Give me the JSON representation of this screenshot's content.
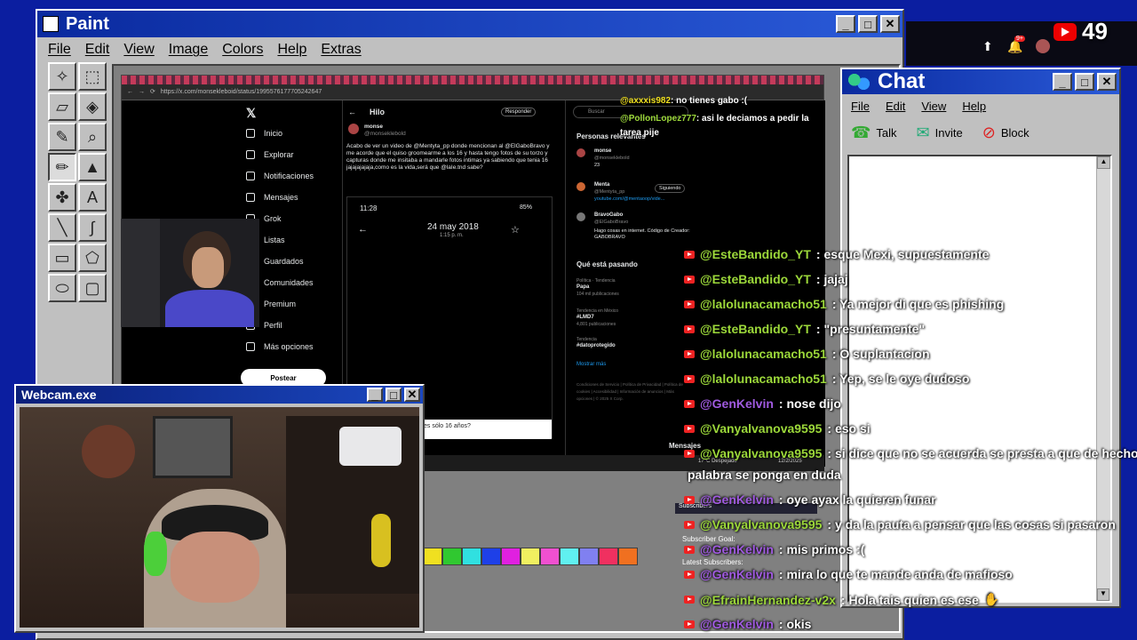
{
  "paint": {
    "title": "Paint",
    "menu": [
      "File",
      "Edit",
      "View",
      "Image",
      "Colors",
      "Help",
      "Extras"
    ],
    "palette": [
      "#f0e020",
      "#30c830",
      "#30e0e0",
      "#1e40e8",
      "#e020e0",
      "#f0f060",
      "#f050d0",
      "#60f0f0",
      "#8080f0",
      "#f03060",
      "#f07020"
    ]
  },
  "browser": {
    "url": "https://x.com/monsekleboid/status/1995576177705242647",
    "tab_reply": "Responder",
    "search_placeholder": "Buscar",
    "nav": [
      "Inicio",
      "Explorar",
      "Notificaciones",
      "Mensajes",
      "Grok",
      "Listas",
      "Guardados",
      "Comunidades",
      "Premium",
      "Perfil",
      "Más opciones"
    ],
    "post_button": "Postear",
    "thread_title": "Hilo",
    "author_name": "monse",
    "author_handle": "@monseklebold",
    "tweet_text": "Acabo de ver un video de @Mentyta_pp donde mencionan al @ElGaboBravo y me acorde que el quiso groomearme a los 16 y hasta tengo fotos de su torzo y capturas donde me insitaba a mandarle fotos intimas ya sabiendo que tenia 16 jajajajajaja,como es la vida,será que @laIe.tnd sabe?",
    "phone_time": "11:28",
    "phone_battery": "85%",
    "phone_date": "24 may 2018",
    "phone_subdate": "1:15 p. m.",
    "phone_caption": "es sólo 16 años?",
    "relevant_title": "Personas relevantes",
    "relevant": [
      {
        "name": "monse",
        "handle": "@monseklebold",
        "extra": "23"
      },
      {
        "name": "Menta",
        "handle": "@Mentyta_pp",
        "extra": "youtube.com/@mentaoop/vide...",
        "action": "Siguiendo"
      },
      {
        "name": "BravoGabo",
        "handle": "@ElGaboBravo",
        "extra": "Hago cosas en internet. Código de Creador: GABOBRAVO"
      }
    ],
    "trending_title": "Qué está pasando",
    "trends": [
      {
        "ctx": "Política · Tendencia",
        "name": "Papa",
        "count": "104 mil publicaciones"
      },
      {
        "ctx": "Tendencia en México",
        "name": "#LMD7",
        "count": "4,801 publicaciones"
      },
      {
        "ctx": "Tendencia",
        "name": "#datoprotegido",
        "count": ""
      }
    ],
    "show_more": "Mostrar más",
    "messages": "Mensajes",
    "footer": "Condiciones de Servicio | Política de Privacidad | Política de cookies | Accesibilidad | Información de anuncios | Más opciones | © 2025 X Corp.",
    "taskbar_weather": "17°C Despejado",
    "taskbar_date": "12/2/2025"
  },
  "webcam": {
    "title": "Webcam.exe"
  },
  "chat": {
    "title": "Chat",
    "menu": [
      "File",
      "Edit",
      "View",
      "Help"
    ],
    "tools": [
      {
        "label": "Talk",
        "icon": "talk-icon"
      },
      {
        "label": "Invite",
        "icon": "invite-icon"
      },
      {
        "label": "Block",
        "icon": "block-icon"
      }
    ]
  },
  "stream": {
    "viewers": "49",
    "notif_count": "9+",
    "overlay_subscribers": "Subscribers",
    "overlay_goal": "Subscriber Goal:",
    "overlay_latest": "Latest Subscribers:"
  },
  "chat_messages": [
    {
      "user": "@axxxis982",
      "text": ": no tienes gabo :(",
      "color": "#f0e020"
    },
    {
      "user": "@PollonLopez777",
      "text": ": asi le deciamos a pedir la tarea pije",
      "color": "#9cd83a"
    },
    {
      "user": "@EsteBandido_YT",
      "text": ": esque Mexi, supuestamente",
      "color": "#9cd83a"
    },
    {
      "user": "@EsteBandido_YT",
      "text": ": jajaj",
      "color": "#9cd83a"
    },
    {
      "user": "@lalolunacamacho51",
      "text": ": Ya mejor di que es phishing",
      "color": "#9cd83a"
    },
    {
      "user": "@EsteBandido_YT",
      "text": ": \"presuntamente\"",
      "color": "#9cd83a"
    },
    {
      "user": "@lalolunacamacho51",
      "text": ": O suplantacion",
      "color": "#9cd83a"
    },
    {
      "user": "@lalolunacamacho51",
      "text": ": Yep, se le oye dudoso",
      "color": "#9cd83a"
    },
    {
      "user": "@GenKelvin",
      "text": ": nose dijo",
      "color": "#a05ae0"
    },
    {
      "user": "@Vanyalvanova9595",
      "text": ": eso si",
      "color": "#9cd83a"
    },
    {
      "user": "@Vanyalvanova9595",
      "text": ": si dice que no se acuerda se presta a que de hecho",
      "color": "#9cd83a"
    },
    {
      "user": "",
      "text": "palabra se ponga en duda",
      "color": "#fff"
    },
    {
      "user": "@GenKelvin",
      "text": ": oye ayax la quieren funar",
      "color": "#a05ae0"
    },
    {
      "user": "@Vanyalvanova9595",
      "text": ": y da la pauta a pensar que las cosas si pasaron",
      "color": "#9cd83a"
    },
    {
      "user": "@GenKelvin",
      "text": ": mis primos :(",
      "color": "#a05ae0"
    },
    {
      "user": "@GenKelvin",
      "text": ": mira lo que te mande anda de mafioso",
      "color": "#a05ae0"
    },
    {
      "user": "@EfrainHernandez-v2x",
      "text": ": Hola tais quien es ese",
      "color": "#9cd83a"
    },
    {
      "user": "@GenKelvin",
      "text": ": okis",
      "color": "#a05ae0"
    }
  ]
}
